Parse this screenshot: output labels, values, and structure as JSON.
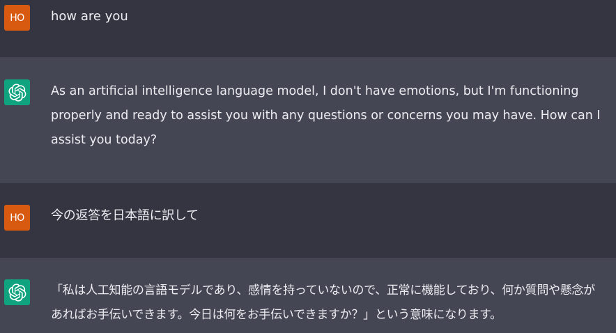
{
  "conversation": {
    "messages": [
      {
        "role": "user",
        "avatar_text": "HO",
        "text": "how are you"
      },
      {
        "role": "assistant",
        "avatar_icon": "openai-logo-icon",
        "text": "As an artificial intelligence language model, I don't have emotions, but I'm functioning properly and ready to assist you with any questions or concerns you may have. How can I assist you today?"
      },
      {
        "role": "user",
        "avatar_text": "HO",
        "text": "今の返答を日本語に訳して"
      },
      {
        "role": "assistant",
        "avatar_icon": "openai-logo-icon",
        "text": "「私は人工知能の言語モデルであり、感情を持っていないので、正常に機能しており、何か質問や懸念があればお手伝いできます。今日は何をお手伝いできますか？」という意味になります。"
      }
    ]
  },
  "colors": {
    "user_row_bg": "#343541",
    "assistant_row_bg": "#444654",
    "user_avatar_bg": "#d75a10",
    "assistant_avatar_bg": "#10a37f",
    "text": "#ececf1"
  }
}
